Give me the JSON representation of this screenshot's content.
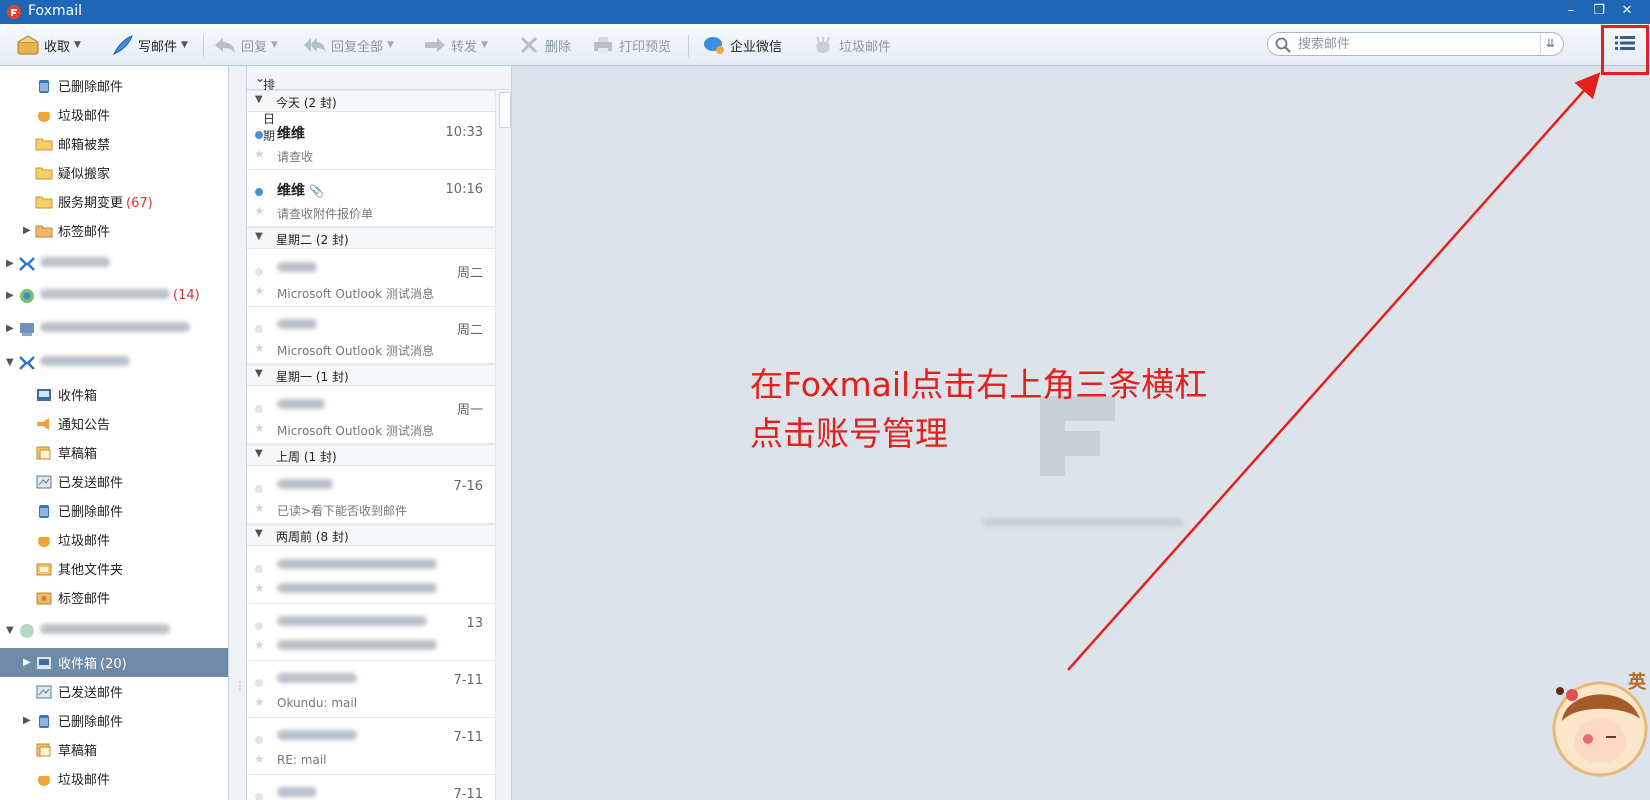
{
  "window": {
    "title": "Foxmail"
  },
  "toolbar": {
    "receive": "收取",
    "compose": "写邮件",
    "reply": "回复",
    "reply_all": "回复全部",
    "forward": "转发",
    "delete": "删除",
    "print_preview": "打印预览",
    "wecom": "企业微信",
    "spam": "垃圾邮件",
    "search_placeholder": "搜索邮件"
  },
  "folders": [
    {
      "label": "已删除邮件",
      "icon": "trash-icon"
    },
    {
      "label": "垃圾邮件",
      "icon": "spam-icon"
    },
    {
      "label": "邮箱被禁",
      "icon": "folder-icon"
    },
    {
      "label": "疑似搬家",
      "icon": "folder-icon"
    },
    {
      "label": "服务期变更",
      "count": "(67)",
      "icon": "folder-icon"
    },
    {
      "label": "标签邮件",
      "icon": "tag-folder-icon"
    },
    {
      "label": "收件箱",
      "icon": "inbox-icon"
    },
    {
      "label": "通知公告",
      "icon": "announce-icon"
    },
    {
      "label": "草稿箱",
      "icon": "drafts-icon"
    },
    {
      "label": "已发送邮件",
      "icon": "sent-icon"
    },
    {
      "label": "已删除邮件",
      "icon": "trash-icon"
    },
    {
      "label": "垃圾邮件",
      "icon": "spam-icon"
    },
    {
      "label": "其他文件夹",
      "icon": "other-folder-icon"
    },
    {
      "label": "标签邮件",
      "icon": "tag-folder-icon"
    },
    {
      "label": "收件箱",
      "count": "(20)",
      "icon": "inbox-icon"
    },
    {
      "label": "已发送邮件",
      "icon": "sent-icon"
    },
    {
      "label": "已删除邮件",
      "icon": "trash-icon"
    },
    {
      "label": "草稿箱",
      "icon": "drafts-icon"
    },
    {
      "label": "垃圾邮件",
      "icon": "spam-icon"
    }
  ],
  "account_counts": {
    "account2": "(14)"
  },
  "mail_list": {
    "sort_label": "排序:日期",
    "groups": [
      {
        "label": "今天 (2 封)"
      },
      {
        "label": "星期二 (2 封)"
      },
      {
        "label": "星期一 (1 封)"
      },
      {
        "label": "上周 (1 封)"
      },
      {
        "label": "两周前 (8 封)"
      }
    ],
    "items": [
      {
        "sender": "维维",
        "time": "10:33",
        "subject": "请查收"
      },
      {
        "sender": "维维",
        "time": "10:16",
        "subject": "请查收附件报价单"
      },
      {
        "sender": "",
        "time": "周二",
        "subject": "Microsoft Outlook 测试消息"
      },
      {
        "sender": "",
        "time": "周二",
        "subject": "Microsoft Outlook 测试消息"
      },
      {
        "sender": "",
        "time": "周一",
        "subject": "Microsoft Outlook 测试消息"
      },
      {
        "sender": "",
        "time": "7-16",
        "subject": "已读>看下能否收到邮件"
      },
      {
        "sender": "",
        "time": "",
        "subject": ""
      },
      {
        "sender": "",
        "time": "13",
        "subject": ""
      },
      {
        "sender": "",
        "time": "7-11",
        "subject": "Okundu: mail"
      },
      {
        "sender": "",
        "time": "7-11",
        "subject": "RE: mail"
      },
      {
        "sender": "",
        "time": "7-11",
        "subject": ""
      }
    ]
  },
  "annotation": {
    "line1": "在Foxmail点击右上角三条横杠",
    "line2": "点击账号管理"
  },
  "ime": {
    "label": "英"
  },
  "colors": {
    "annotation_red": "#e3201a",
    "titlebar_blue": "#1f67b4",
    "selected_row": "#6e8aa6",
    "unread_dot": "#4d8fd6",
    "count_red": "#e03030"
  }
}
